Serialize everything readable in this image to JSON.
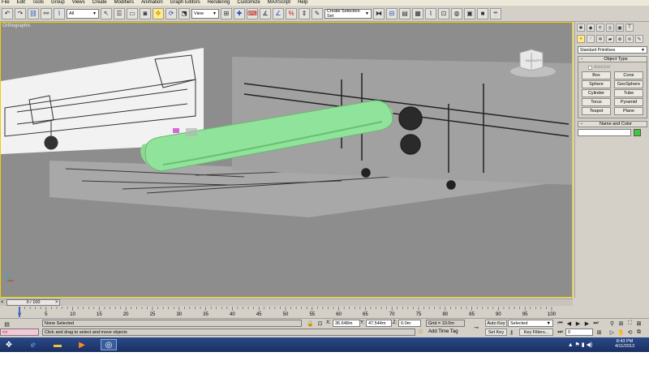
{
  "menu": [
    "File",
    "Edit",
    "Tools",
    "Group",
    "Views",
    "Create",
    "Modifiers",
    "Animation",
    "Graph Editors",
    "Rendering",
    "Customize",
    "MAXScript",
    "Help"
  ],
  "toolbar": {
    "selection_filter": "All",
    "ref_coord": "View",
    "named_selection": "Create Selection Set"
  },
  "viewport": {
    "label": "Orthographic",
    "viewcube_front": "BACK",
    "viewcube_side": "LEFT",
    "object_color": "#90e39a"
  },
  "command_panel": {
    "category": "Standard Primitives",
    "object_type_title": "Object Type",
    "autogrid": "AutoGrid",
    "buttons": [
      "Box",
      "Cone",
      "Sphere",
      "GeoSphere",
      "Cylinder",
      "Tube",
      "Torus",
      "Pyramid",
      "Teapot",
      "Plane"
    ],
    "name_color_title": "Name and Color",
    "object_name": "",
    "swatch_color": "#3ec83e"
  },
  "timeslider": {
    "label": "0 / 100",
    "prev": "<",
    "next": ">"
  },
  "trackbar": {
    "ticks": [
      "0",
      "5",
      "10",
      "15",
      "20",
      "25",
      "30",
      "35",
      "40",
      "45",
      "50",
      "55",
      "60",
      "65",
      "70",
      "75",
      "80",
      "85",
      "90",
      "95",
      "100"
    ]
  },
  "status": {
    "selection": "None Selected",
    "prompt": "Click and drag to select and move objects",
    "x_label": "X:",
    "x_value": "36.648m",
    "y_label": "Y:",
    "y_value": "47.544m",
    "z_label": "Z:",
    "z_value": "0.0m",
    "grid": "Grid = 10.0m",
    "add_time_tag": "Add Time Tag",
    "auto_key": "Auto Key",
    "set_key": "Set Key",
    "key_mode": "Selected",
    "key_filters": "Key Filters...",
    "frame": "0",
    "maxscript_prompt": "<<"
  },
  "tray": {
    "time": "8:43 PM",
    "date": "4/11/2013"
  }
}
